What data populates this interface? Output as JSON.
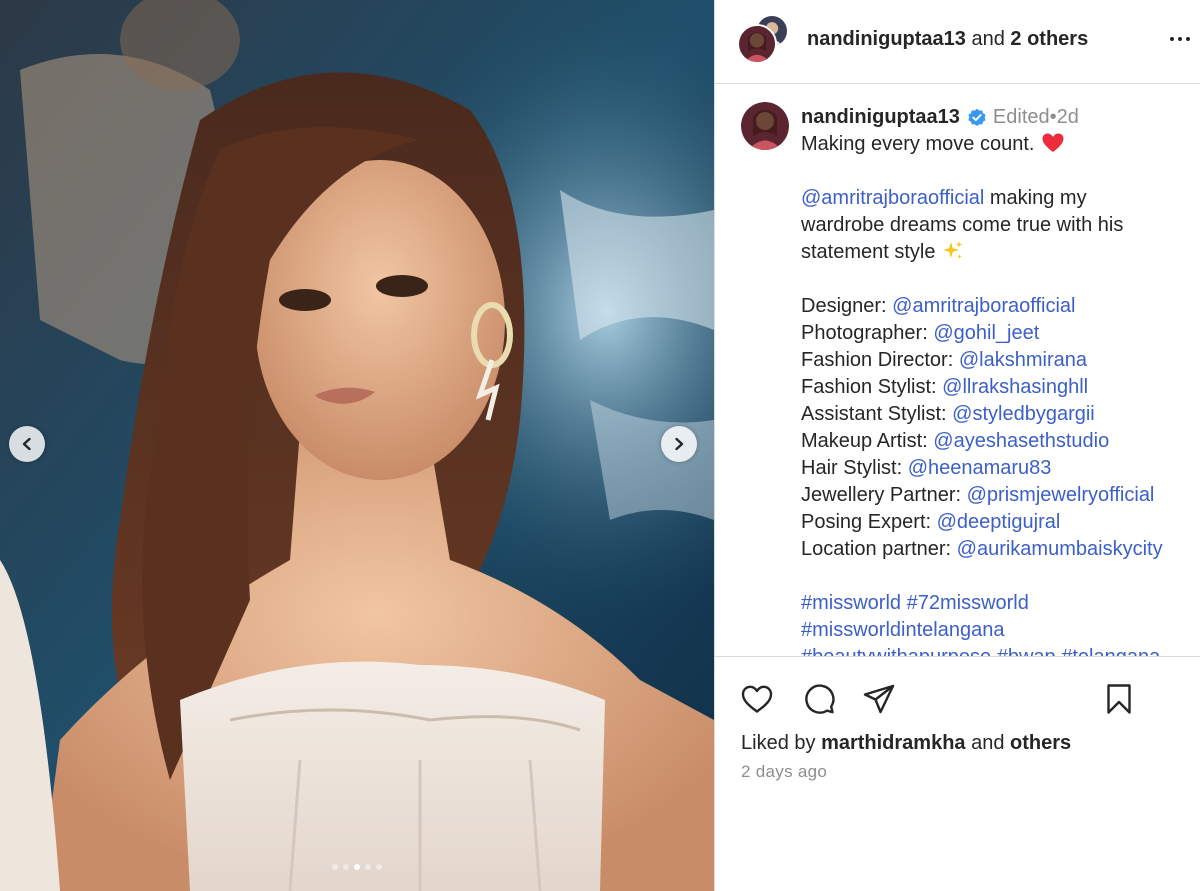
{
  "media": {
    "image_description_icon": "photo",
    "carousel_dots": [
      false,
      false,
      true,
      false,
      false
    ]
  },
  "header": {
    "username": "nandiniguptaa13",
    "and_text": " and ",
    "others_text": "2 others"
  },
  "caption": {
    "username": "nandiniguptaa13",
    "edited": "Edited",
    "separator": " • ",
    "age": "2d",
    "first_line": "Making every move count.",
    "mention_line": {
      "mention": "@amritrajboraofficial",
      "text": " making my"
    },
    "line2": "wardrobe dreams come true with his",
    "line3": "statement style",
    "credits": [
      {
        "label": "Designer: ",
        "handle": "@amritrajboraofficial"
      },
      {
        "label": "Photographer: ",
        "handle": "@gohil_jeet"
      },
      {
        "label": "Fashion Director: ",
        "handle": "@lakshmirana"
      },
      {
        "label": "Fashion Stylist: ",
        "handle": "@llrakshasinghll"
      },
      {
        "label": "Assistant Stylist: ",
        "handle": "@styledbygargii"
      },
      {
        "label": "Makeup Artist: ",
        "handle": "@ayeshasethstudio"
      },
      {
        "label": "Hair Stylist: ",
        "handle": "@heenamaru83"
      },
      {
        "label": "Jewellery Partner: ",
        "handle": "@prismjewelryofficial"
      },
      {
        "label": "Posing Expert: ",
        "handle": "@deeptigujral"
      },
      {
        "label": "Location partner: ",
        "handle": "@aurikamumbaiskycity"
      }
    ],
    "hashtags_line1": [
      "#missworld",
      "#72missworld"
    ],
    "hashtags_line2": [
      "#missworldintelangana"
    ],
    "hashtags_line3": [
      "#beautywithapurpose",
      "#bwap",
      "#telangana"
    ]
  },
  "actions": {
    "liked_by_prefix": "Liked by ",
    "liked_by_user": "marthidramkha",
    "liked_by_and": " and ",
    "liked_by_others": "others",
    "time_ago": "2 days ago"
  },
  "colors": {
    "link": "#3c5fc8",
    "verified": "#3897f0",
    "heart": "#ed2d3c"
  }
}
